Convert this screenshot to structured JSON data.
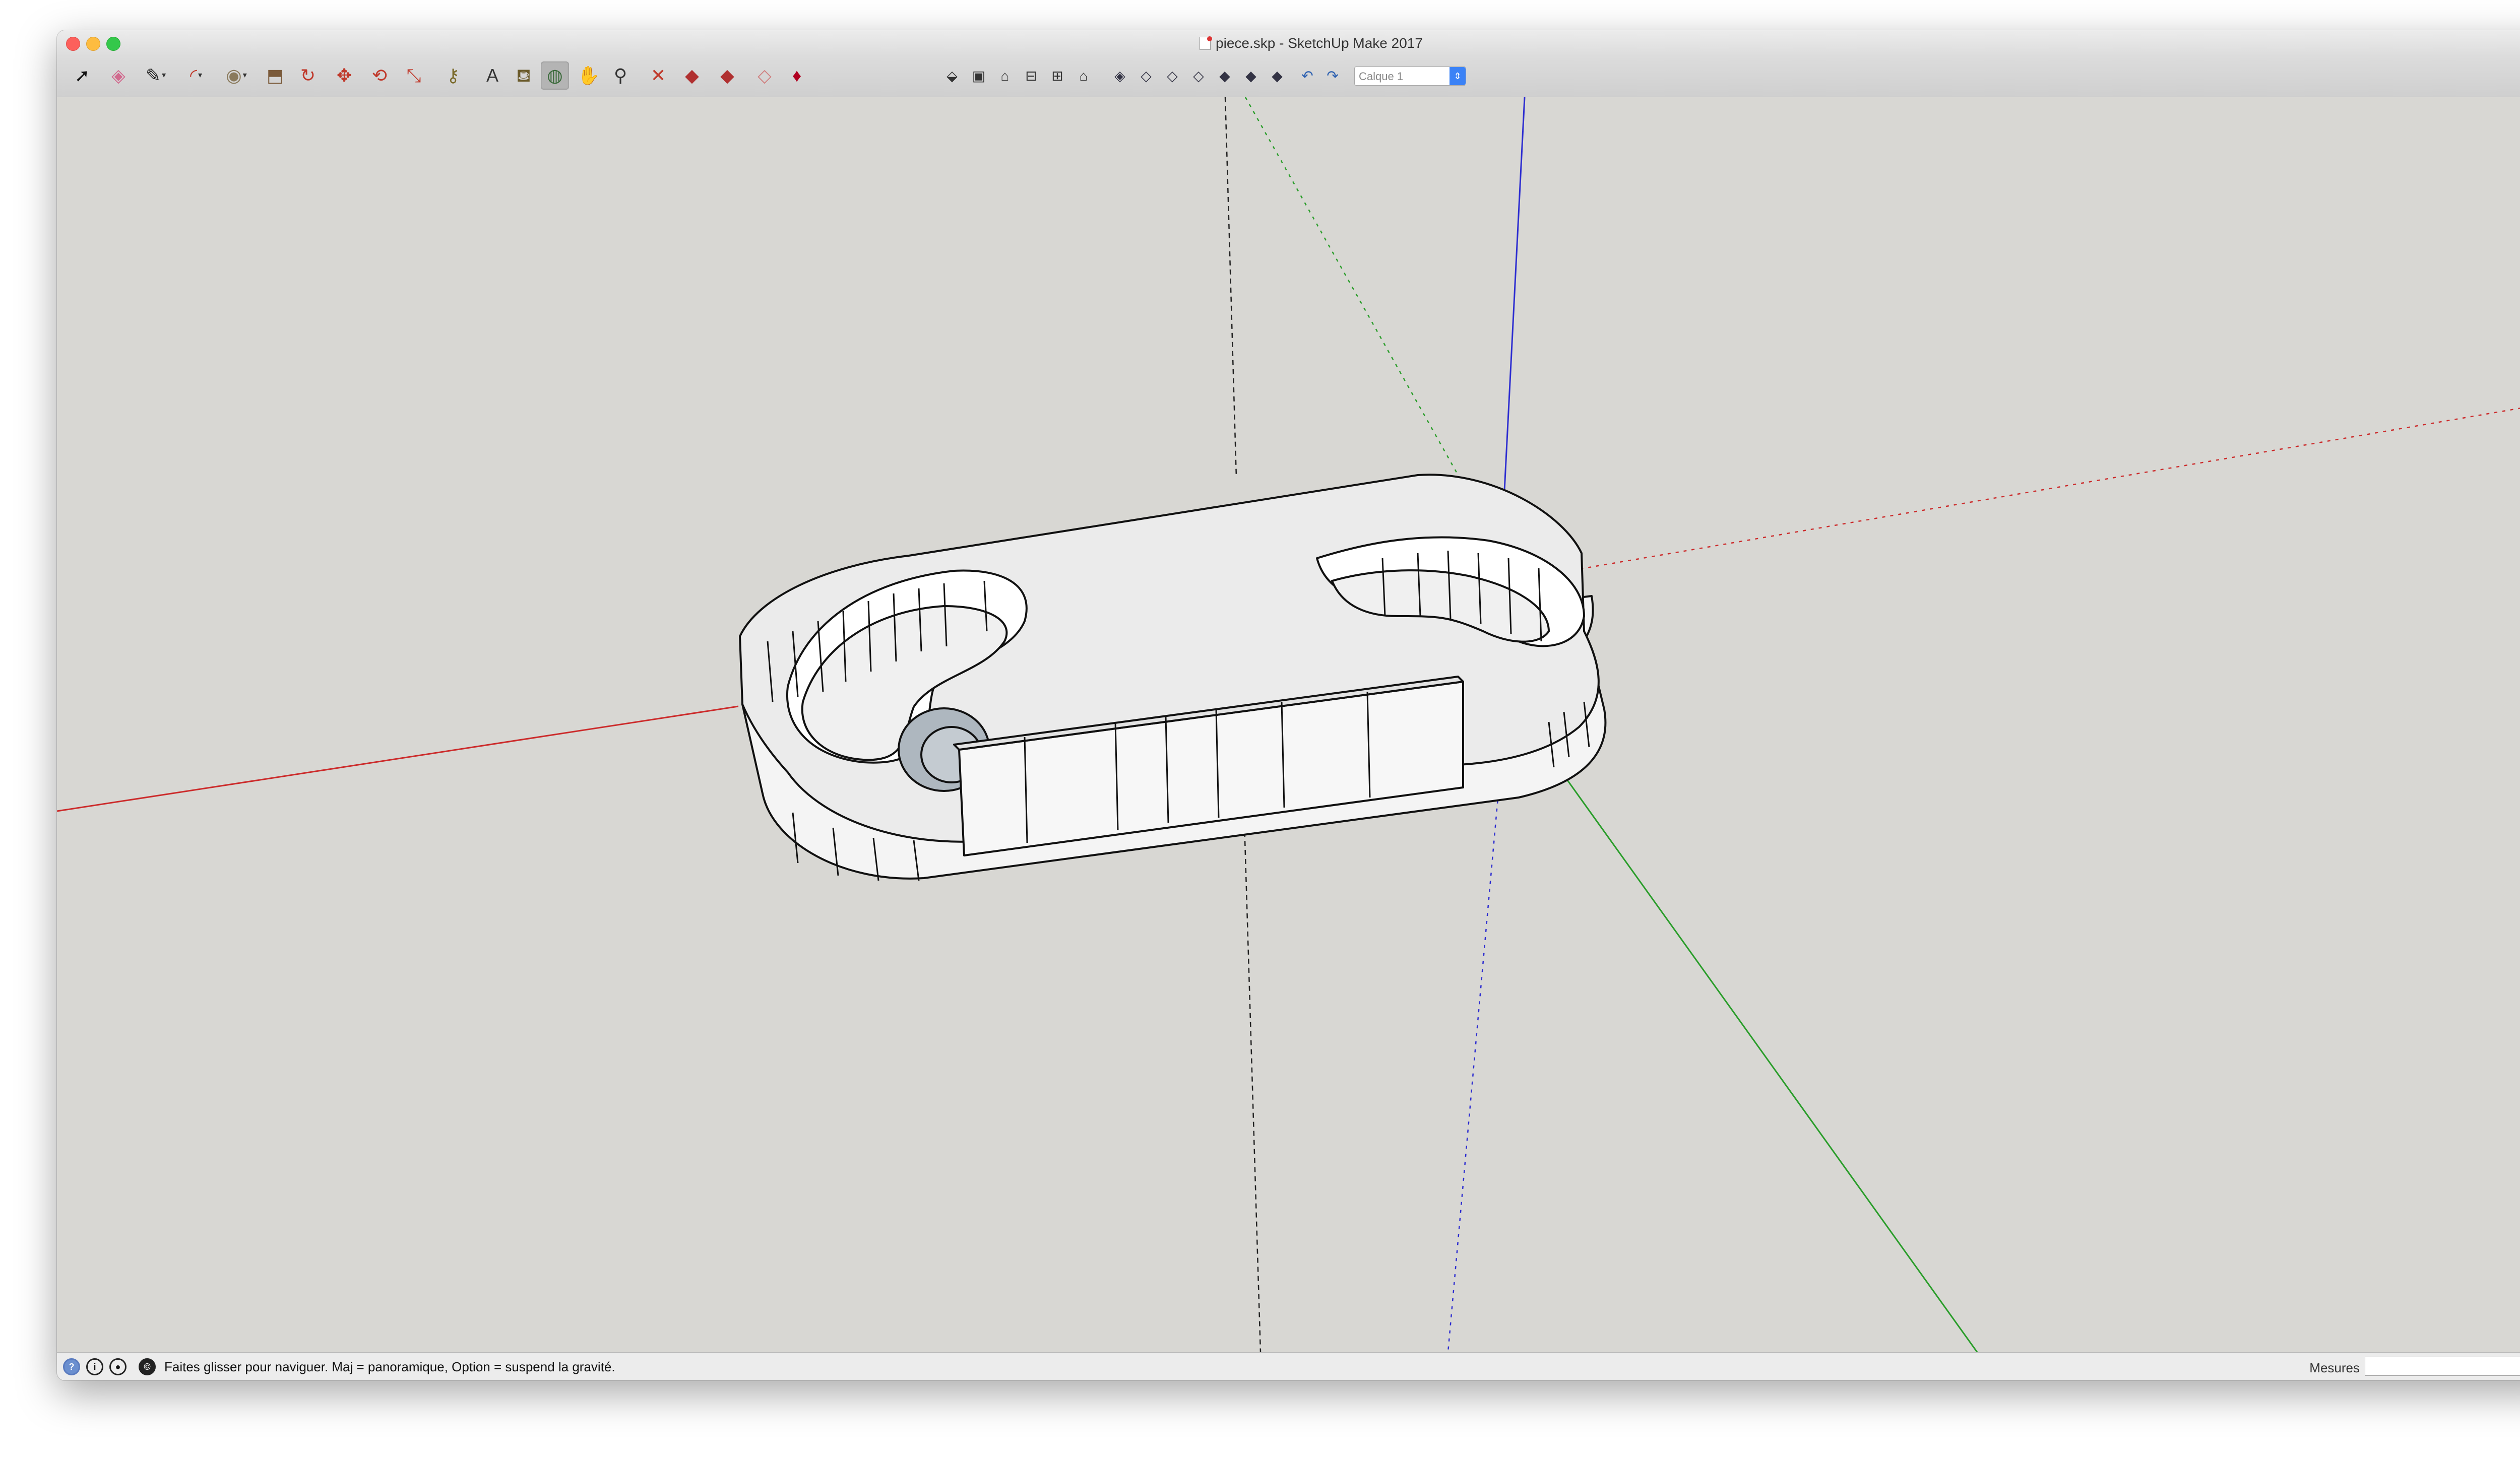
{
  "window": {
    "title": "piece.skp - SketchUp Make 2017"
  },
  "toolbar": {
    "tools": [
      {
        "name": "select-tool",
        "glyph": "➚",
        "color": "#111111"
      },
      {
        "name": "eraser-tool",
        "glyph": "◈",
        "color": "#d16a8e"
      },
      {
        "name": "line-tool",
        "glyph": "✎",
        "color": "#222222",
        "caret": true
      },
      {
        "name": "arc-tool",
        "glyph": "◜",
        "color": "#c0392b",
        "caret": true
      },
      {
        "name": "shape-tool",
        "glyph": "◉",
        "color": "#8a7a5c",
        "caret": true
      },
      {
        "name": "push-pull-tool",
        "glyph": "⬒",
        "color": "#7a5a3a"
      },
      {
        "name": "follow-me-tool",
        "glyph": "↻",
        "color": "#c0392b"
      },
      {
        "name": "move-tool",
        "glyph": "✥",
        "color": "#c0392b"
      },
      {
        "name": "rotate-tool",
        "glyph": "⟲",
        "color": "#c0392b"
      },
      {
        "name": "scale-tool",
        "glyph": "⤡",
        "color": "#c0392b"
      },
      {
        "name": "tape-measure-tool",
        "glyph": "⚷",
        "color": "#7a6a2a"
      },
      {
        "name": "text-tool",
        "glyph": "A",
        "color": "#333333"
      },
      {
        "name": "paint-bucket-tool",
        "glyph": "⛾",
        "color": "#6a5a2a"
      },
      {
        "name": "orbit-tool",
        "glyph": "◍",
        "color": "#3a6a3a",
        "active": true
      },
      {
        "name": "pan-tool",
        "glyph": "✋",
        "color": "#c89a4a"
      },
      {
        "name": "zoom-tool",
        "glyph": "⚲",
        "color": "#333333"
      },
      {
        "name": "zoom-extents-tool",
        "glyph": "✕",
        "color": "#c0392b"
      },
      {
        "name": "warehouse-tool",
        "glyph": "◆",
        "color": "#b03030"
      },
      {
        "name": "share-model-tool",
        "glyph": "◆",
        "color": "#b03030"
      },
      {
        "name": "extension-warehouse-tool",
        "glyph": "◇",
        "color": "#d08080"
      },
      {
        "name": "sketchup-ruby-tool",
        "glyph": "♦",
        "color": "#b00020"
      }
    ],
    "views": [
      {
        "name": "iso-view",
        "glyph": "⬙"
      },
      {
        "name": "top-view",
        "glyph": "▣"
      },
      {
        "name": "front-view",
        "glyph": "⌂"
      },
      {
        "name": "right-view",
        "glyph": "⊟"
      },
      {
        "name": "back-view",
        "glyph": "⊞"
      },
      {
        "name": "left-view",
        "glyph": "⌂"
      }
    ],
    "styles": [
      {
        "name": "xray-style",
        "glyph": "◈"
      },
      {
        "name": "back-edges-style",
        "glyph": "◇"
      },
      {
        "name": "wireframe-style",
        "glyph": "◇"
      },
      {
        "name": "hidden-line-style",
        "glyph": "◇"
      },
      {
        "name": "shaded-style",
        "glyph": "◆"
      },
      {
        "name": "shaded-textures-style",
        "glyph": "◆"
      },
      {
        "name": "monochrome-style",
        "glyph": "◆"
      }
    ],
    "history": [
      {
        "name": "undo",
        "glyph": "↶"
      },
      {
        "name": "redo",
        "glyph": "↷"
      }
    ],
    "layer_select": "Calque 1"
  },
  "statusbar": {
    "hint": "Faites glisser pour naviguer. Maj = panoramique, Option =  suspend la gravité.",
    "measures_label": "Mesures",
    "measures_value": ""
  },
  "viewport": {
    "axis_colors": {
      "red": "#cc2b2b",
      "green": "#2a9d2a",
      "blue": "#2d2dd0"
    }
  }
}
